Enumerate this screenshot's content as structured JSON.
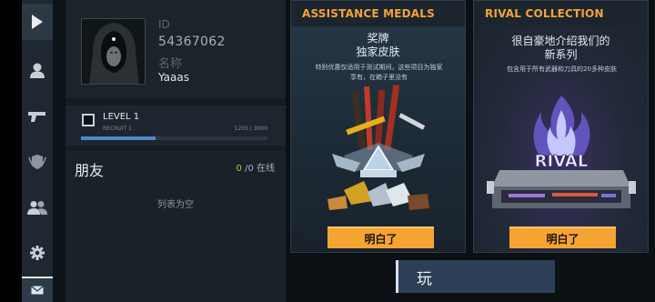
{
  "sidebar": {
    "items": [
      {
        "icon": "play-icon"
      },
      {
        "icon": "profile-icon"
      },
      {
        "icon": "weapon-icon"
      },
      {
        "icon": "clan-emblem-icon"
      },
      {
        "icon": "friends-icon"
      },
      {
        "icon": "settings-icon"
      },
      {
        "icon": "mail-icon"
      }
    ]
  },
  "profile": {
    "id_label": "ID",
    "id_value": "54367062",
    "name_label": "名称",
    "name_value": "Yaaas",
    "level_title": "LEVEL 1",
    "level_rank": "RECRUIT 1",
    "xp_text": "1205 | 3000",
    "xp_progress": 0.4017
  },
  "friends": {
    "title": "朋友",
    "online_count": "0",
    "online_rest": " /0 在线",
    "empty_text": "列表为空"
  },
  "offers": [
    {
      "title": "ASSISTANCE MEDALS",
      "heading_line1": "奖牌",
      "heading_line2": "独家皮肤",
      "desc_line1": "特别优惠仅适用于测试期间，这些项目为独家",
      "desc_line2": "享有，在箱子里没有",
      "button": "明白了"
    },
    {
      "title": "RIVAL COLLECTION",
      "heading_line1": "很自豪地介绍我们的",
      "heading_line2": "新系列",
      "desc_line1": "包含用于所有武器和刀具的20多种皮肤",
      "art_text": "RIVAL",
      "button": "明白了"
    }
  ],
  "play_button": "玩",
  "colors": {
    "accent_orange": "#f5a432",
    "xp_blue": "#4f89c4",
    "online_green": "#8fd24a",
    "sidebar_bg": "#1f2831"
  }
}
